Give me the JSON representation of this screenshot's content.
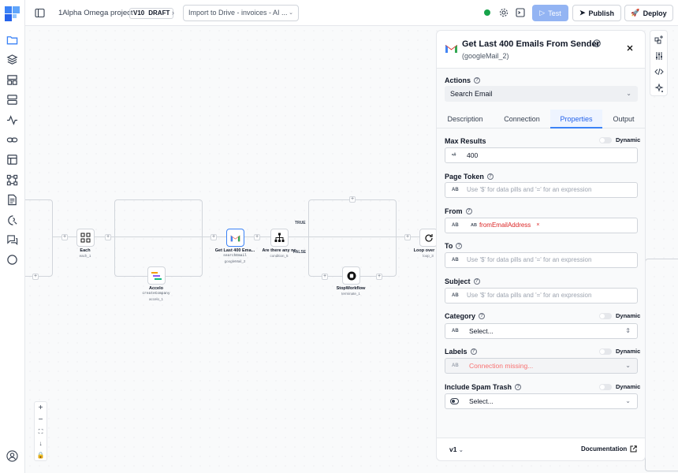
{
  "header": {
    "project_name": "1Alpha Omega project",
    "version": "V10",
    "version_state": "DRAFT",
    "flow_name": "Import to Drive - invoices - AI ...",
    "test_label": "Test",
    "publish_label": "Publish",
    "deploy_label": "Deploy"
  },
  "canvas": {
    "nodes": {
      "each": {
        "title": "Each",
        "sub": "each_1"
      },
      "accelo": {
        "title": "Accelo",
        "method": "createCompany",
        "sub": "accelo_1"
      },
      "gmail": {
        "title": "Get Last 400 Ema...",
        "method": "searchEmail",
        "sub": "googleMail_2"
      },
      "condition": {
        "title": "Are there any ne",
        "sub": "condition_5"
      },
      "stop": {
        "title": "StopWorkflow",
        "sub": "terminate_1"
      },
      "loop": {
        "title": "Loop over Em",
        "sub": "loop_3"
      }
    },
    "branch_true": "TRUE",
    "branch_false": "FALSE"
  },
  "zoom": {
    "plus": "+",
    "minus": "−"
  },
  "panel": {
    "title": "Get Last 400 Emails From Sender",
    "subtitle": "(googleMail_2)",
    "actions_label": "Actions",
    "action_value": "Search Email",
    "tabs": [
      "Description",
      "Connection",
      "Properties",
      "Output"
    ],
    "active_tab": "Properties",
    "dynamic_label": "Dynamic",
    "fields": {
      "max_results": {
        "label": "Max Results",
        "type": "•#",
        "value": "400"
      },
      "page_token": {
        "label": "Page Token",
        "type": "AB",
        "placeholder": "Use '$' for data pills and '=' for an expression"
      },
      "from": {
        "label": "From",
        "type": "AB",
        "pill_type": "AB",
        "pill_value": "fromEmailAddress"
      },
      "to": {
        "label": "To",
        "type": "AB",
        "placeholder": "Use '$' for data pills and '=' for an expression"
      },
      "subject": {
        "label": "Subject",
        "type": "AB",
        "placeholder": "Use '$' for data pills and '=' for an expression"
      },
      "category": {
        "label": "Category",
        "type": "AB",
        "value": "Select..."
      },
      "labels": {
        "label": "Labels",
        "type": "AB",
        "value": "Connection missing..."
      },
      "spam": {
        "label": "Include Spam Trash",
        "value": "Select..."
      }
    },
    "footer": {
      "version": "v1",
      "documentation": "Documentation"
    }
  },
  "colors": {
    "accent": "#3b82f6",
    "error": "#dc2626",
    "status": "#16a34a"
  }
}
